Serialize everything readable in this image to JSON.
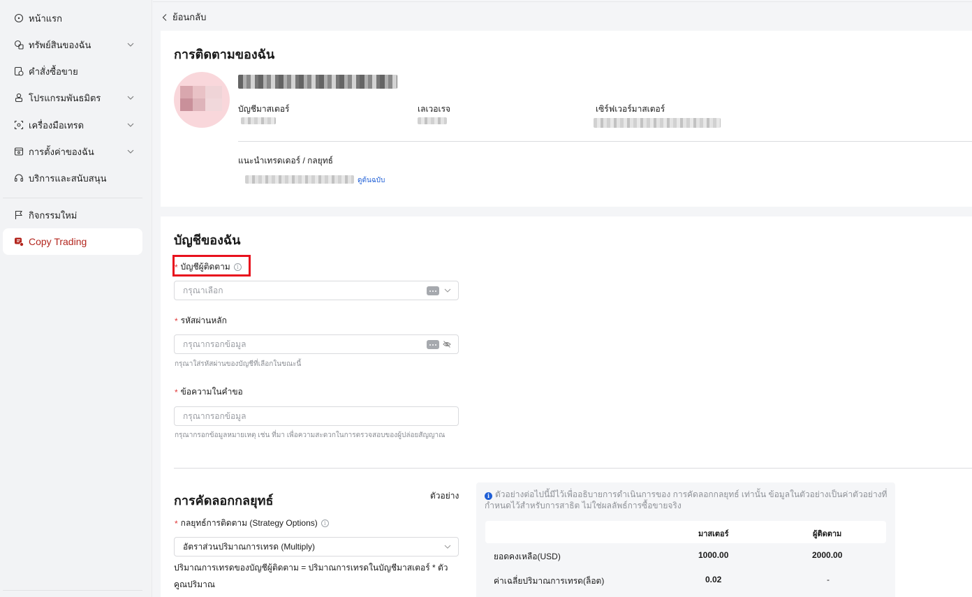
{
  "sidebar": {
    "items": [
      {
        "label": "หน้าแรก",
        "icon": "home-icon"
      },
      {
        "label": "ทรัพย์สินของฉัน",
        "icon": "wallet-icon"
      },
      {
        "label": "คำสั่งซื้อขาย",
        "icon": "orders-icon"
      },
      {
        "label": "โปรแกรมพันธมิตร",
        "icon": "partner-icon"
      },
      {
        "label": "เครื่องมือเทรด",
        "icon": "tools-icon"
      },
      {
        "label": "การตั้งค่าของฉัน",
        "icon": "settings-icon"
      },
      {
        "label": "บริการและสนับสนุน",
        "icon": "headset-icon"
      },
      {
        "label": "กิจกรรมใหม่",
        "icon": "flag-icon"
      },
      {
        "label": "Copy Trading",
        "icon": "copy-trading-icon"
      }
    ],
    "active_color": "#b3261e"
  },
  "header": {
    "back_label": "ย้อนกลับ"
  },
  "following": {
    "title": "การติดตามของฉัน",
    "master_account_label": "บัญชีมาสเตอร์",
    "leverage_label": "เลเวอเรจ",
    "master_server_label": "เซิร์ฟเวอร์มาสเตอร์",
    "intro_label": "แนะนำเทรดเดอร์ / กลยุทธ์",
    "view_original_link": "ดูต้นฉบับ"
  },
  "my_account": {
    "title": "บัญชีของฉัน",
    "follower_account": {
      "label": "บัญชีผู้ติดตาม",
      "placeholder": "กรุณาเลือก"
    },
    "main_password": {
      "label": "รหัสผ่านหลัก",
      "placeholder": "กรุณากรอกข้อมูล",
      "hint": "กรุณาใส่รหัสผ่านของบัญชีที่เลือกในขณะนี้"
    },
    "request_message": {
      "label": "ข้อความในคำขอ",
      "placeholder": "กรุณากรอกข้อมูล",
      "hint": "กรุณากรอกข้อมูลหมายเหตุ เช่น ที่มา เพื่อความสะดวกในการตรวจสอบของผู้ปล่อยสัญญาณ"
    }
  },
  "strategy": {
    "title": "การคัดลอกกลยุทธ์",
    "example_link": "ตัวอย่าง",
    "options_label": "กลยุทธ์การติดตาม (Strategy Options)",
    "selected_option": "อัตราส่วนปริมาณการเทรด (Multiply)",
    "formula": "ปริมาณการเทรดของบัญชีผู้ติดตาม = ปริมาณการเทรดในบัญชีมาสเตอร์ * ตัวคูณปริมาณ",
    "example": {
      "note": "ตัวอย่างต่อไปนี้มีไว้เพื่ออธิบายการดำเนินการของ การคัดลอกกลยุทธ์ เท่านั้น ข้อมูลในตัวอย่างเป็นค่าตัวอย่างที่กำหนดไว้สำหรับการสาธิต ไม่ใช่ผลลัพธ์การซื้อขายจริง",
      "col_master": "มาสเตอร์",
      "col_follower": "ผู้ติดตาม",
      "rows": [
        {
          "label": "ยอดคงเหลือ(USD)",
          "master": "1000.00",
          "follower": "2000.00"
        },
        {
          "label": "ค่าเฉลี่ยปริมาณการเทรด(ล็อต)",
          "master": "0.02",
          "follower": "-"
        }
      ]
    }
  }
}
